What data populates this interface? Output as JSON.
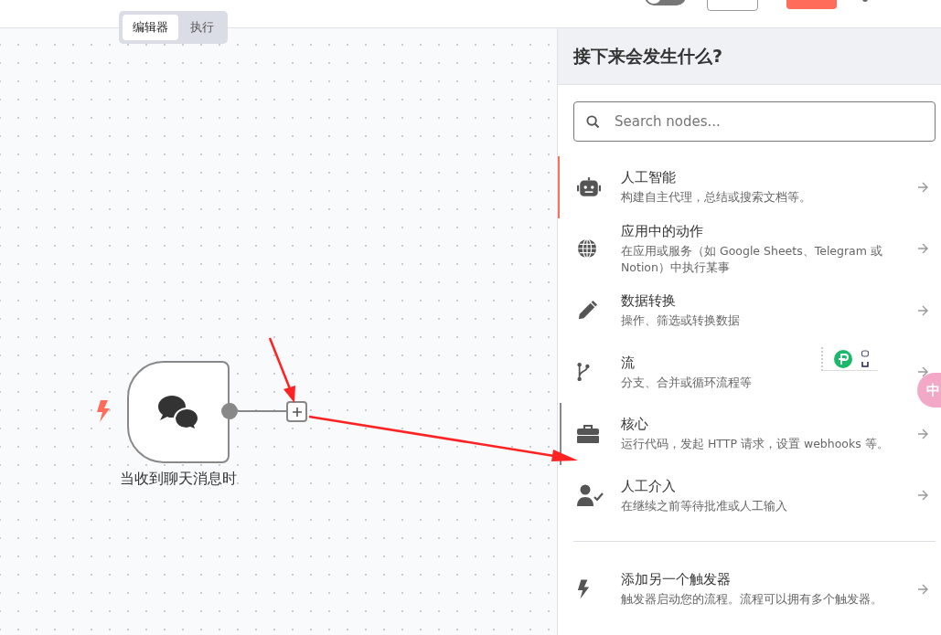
{
  "toggle": {
    "on": false
  },
  "tabs": [
    {
      "label": "编辑器",
      "selected": true
    },
    {
      "label": "执行",
      "selected": false
    }
  ],
  "canvas": {
    "node": {
      "label": "当收到聊天消息时"
    }
  },
  "panel": {
    "title": "接下来会发生什么?",
    "search": {
      "placeholder": "Search nodes..."
    },
    "items": [
      {
        "kind": "robot",
        "title": "人工智能",
        "description": "构建自主代理，总结或搜索文档等。",
        "selected": true,
        "hovered": false
      },
      {
        "kind": "globe",
        "title": "应用中的动作",
        "description": "在应用或服务（如 Google Sheets、Telegram 或 Notion）中执行某事",
        "selected": false,
        "hovered": false
      },
      {
        "kind": "pencil",
        "title": "数据转换",
        "description": "操作、筛选或转换数据",
        "selected": false,
        "hovered": false
      },
      {
        "kind": "branch",
        "title": "流",
        "description": "分支、合并或循环流程等",
        "selected": false,
        "hovered": false
      },
      {
        "kind": "toolbox",
        "title": "核心",
        "description": "运行代码，发起 HTTP 请求，设置 webhooks 等。",
        "selected": false,
        "hovered": true
      },
      {
        "kind": "person",
        "title": "人工介入",
        "description": "在继续之前等待批准或人工输入",
        "selected": false,
        "hovered": false
      }
    ],
    "trigger": {
      "kind": "bolt",
      "title": "添加另一个触发器",
      "description": "触发器启动您的流程。流程可以拥有多个触发器。",
      "selected": false,
      "hovered": false
    }
  },
  "floating_bubble": {
    "label": "中"
  }
}
